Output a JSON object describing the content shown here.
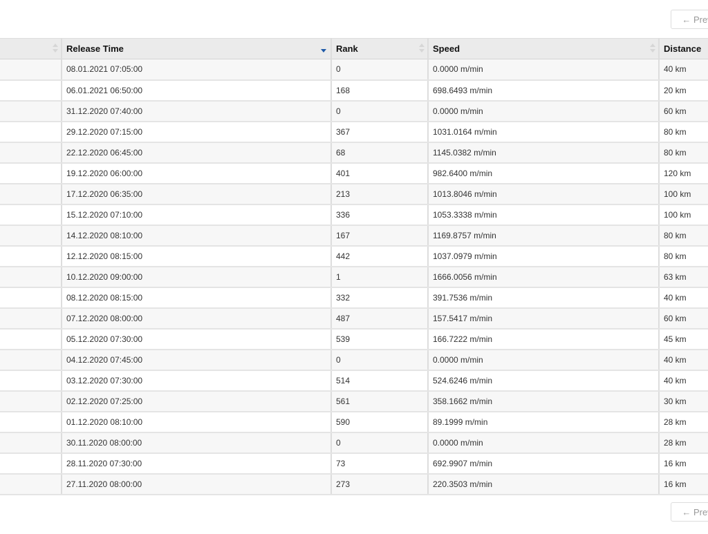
{
  "pagination": {
    "prev_label": "← Prev"
  },
  "table": {
    "columns": [
      {
        "label": ""
      },
      {
        "label": "Release Time"
      },
      {
        "label": "Rank"
      },
      {
        "label": "Speed"
      },
      {
        "label": "Distance"
      }
    ],
    "sorted_column": "Release Time",
    "sort_direction": "descending",
    "rows": [
      {
        "release_time": "08.01.2021 07:05:00",
        "rank": "0",
        "speed": "0.0000 m/min",
        "distance": "40 km"
      },
      {
        "release_time": "06.01.2021 06:50:00",
        "rank": "168",
        "speed": "698.6493 m/min",
        "distance": "20 km"
      },
      {
        "release_time": "31.12.2020 07:40:00",
        "rank": "0",
        "speed": "0.0000 m/min",
        "distance": "60 km"
      },
      {
        "release_time": "29.12.2020 07:15:00",
        "rank": "367",
        "speed": "1031.0164 m/min",
        "distance": "80 km"
      },
      {
        "release_time": "22.12.2020 06:45:00",
        "rank": "68",
        "speed": "1145.0382 m/min",
        "distance": "80 km"
      },
      {
        "release_time": "19.12.2020 06:00:00",
        "rank": "401",
        "speed": "982.6400 m/min",
        "distance": "120 km"
      },
      {
        "release_time": "17.12.2020 06:35:00",
        "rank": "213",
        "speed": "1013.8046 m/min",
        "distance": "100 km"
      },
      {
        "release_time": "15.12.2020 07:10:00",
        "rank": "336",
        "speed": "1053.3338 m/min",
        "distance": "100 km"
      },
      {
        "release_time": "14.12.2020 08:10:00",
        "rank": "167",
        "speed": "1169.8757 m/min",
        "distance": "80 km"
      },
      {
        "release_time": "12.12.2020 08:15:00",
        "rank": "442",
        "speed": "1037.0979 m/min",
        "distance": "80 km"
      },
      {
        "release_time": "10.12.2020 09:00:00",
        "rank": "1",
        "speed": "1666.0056 m/min",
        "distance": "63 km"
      },
      {
        "release_time": "08.12.2020 08:15:00",
        "rank": "332",
        "speed": "391.7536 m/min",
        "distance": "40 km"
      },
      {
        "release_time": "07.12.2020 08:00:00",
        "rank": "487",
        "speed": "157.5417 m/min",
        "distance": "60 km"
      },
      {
        "release_time": "05.12.2020 07:30:00",
        "rank": "539",
        "speed": "166.7222 m/min",
        "distance": "45 km"
      },
      {
        "release_time": "04.12.2020 07:45:00",
        "rank": "0",
        "speed": "0.0000 m/min",
        "distance": "40 km"
      },
      {
        "release_time": "03.12.2020 07:30:00",
        "rank": "514",
        "speed": "524.6246 m/min",
        "distance": "40 km"
      },
      {
        "release_time": "02.12.2020 07:25:00",
        "rank": "561",
        "speed": "358.1662 m/min",
        "distance": "30 km"
      },
      {
        "release_time": "01.12.2020 08:10:00",
        "rank": "590",
        "speed": "89.1999 m/min",
        "distance": "28 km"
      },
      {
        "release_time": "30.11.2020 08:00:00",
        "rank": "0",
        "speed": "0.0000 m/min",
        "distance": "28 km"
      },
      {
        "release_time": "28.11.2020 07:30:00",
        "rank": "73",
        "speed": "692.9907 m/min",
        "distance": "16 km"
      },
      {
        "release_time": "27.11.2020 08:00:00",
        "rank": "273",
        "speed": "220.3503 m/min",
        "distance": "16 km"
      }
    ]
  }
}
